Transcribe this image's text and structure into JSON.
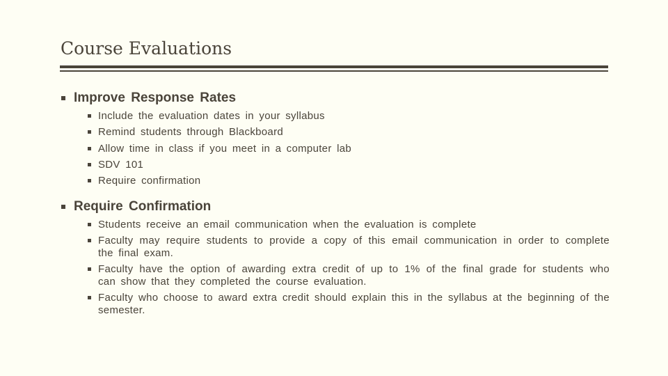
{
  "slide": {
    "title": "Course Evaluations",
    "colors": {
      "background": "#fefef4",
      "text": "#4a443a",
      "rule": "#4a443a"
    },
    "sections": [
      {
        "heading": "Improve Response Rates",
        "items": [
          "Include the evaluation dates in your syllabus",
          "Remind students through Blackboard",
          "Allow time in class if you meet in a computer lab",
          "SDV 101",
          "Require confirmation"
        ]
      },
      {
        "heading": "Require Confirmation",
        "items": [
          "Students receive an email communication when the evaluation is complete",
          "Faculty may require students to provide a copy of this email communication in order to complete the final exam.",
          "Faculty have the option of awarding extra credit of up to 1% of the final grade for students who can show that they completed the course evaluation.",
          "Faculty who choose to award extra credit should explain this in the syllabus at the beginning of the semester."
        ]
      }
    ]
  }
}
